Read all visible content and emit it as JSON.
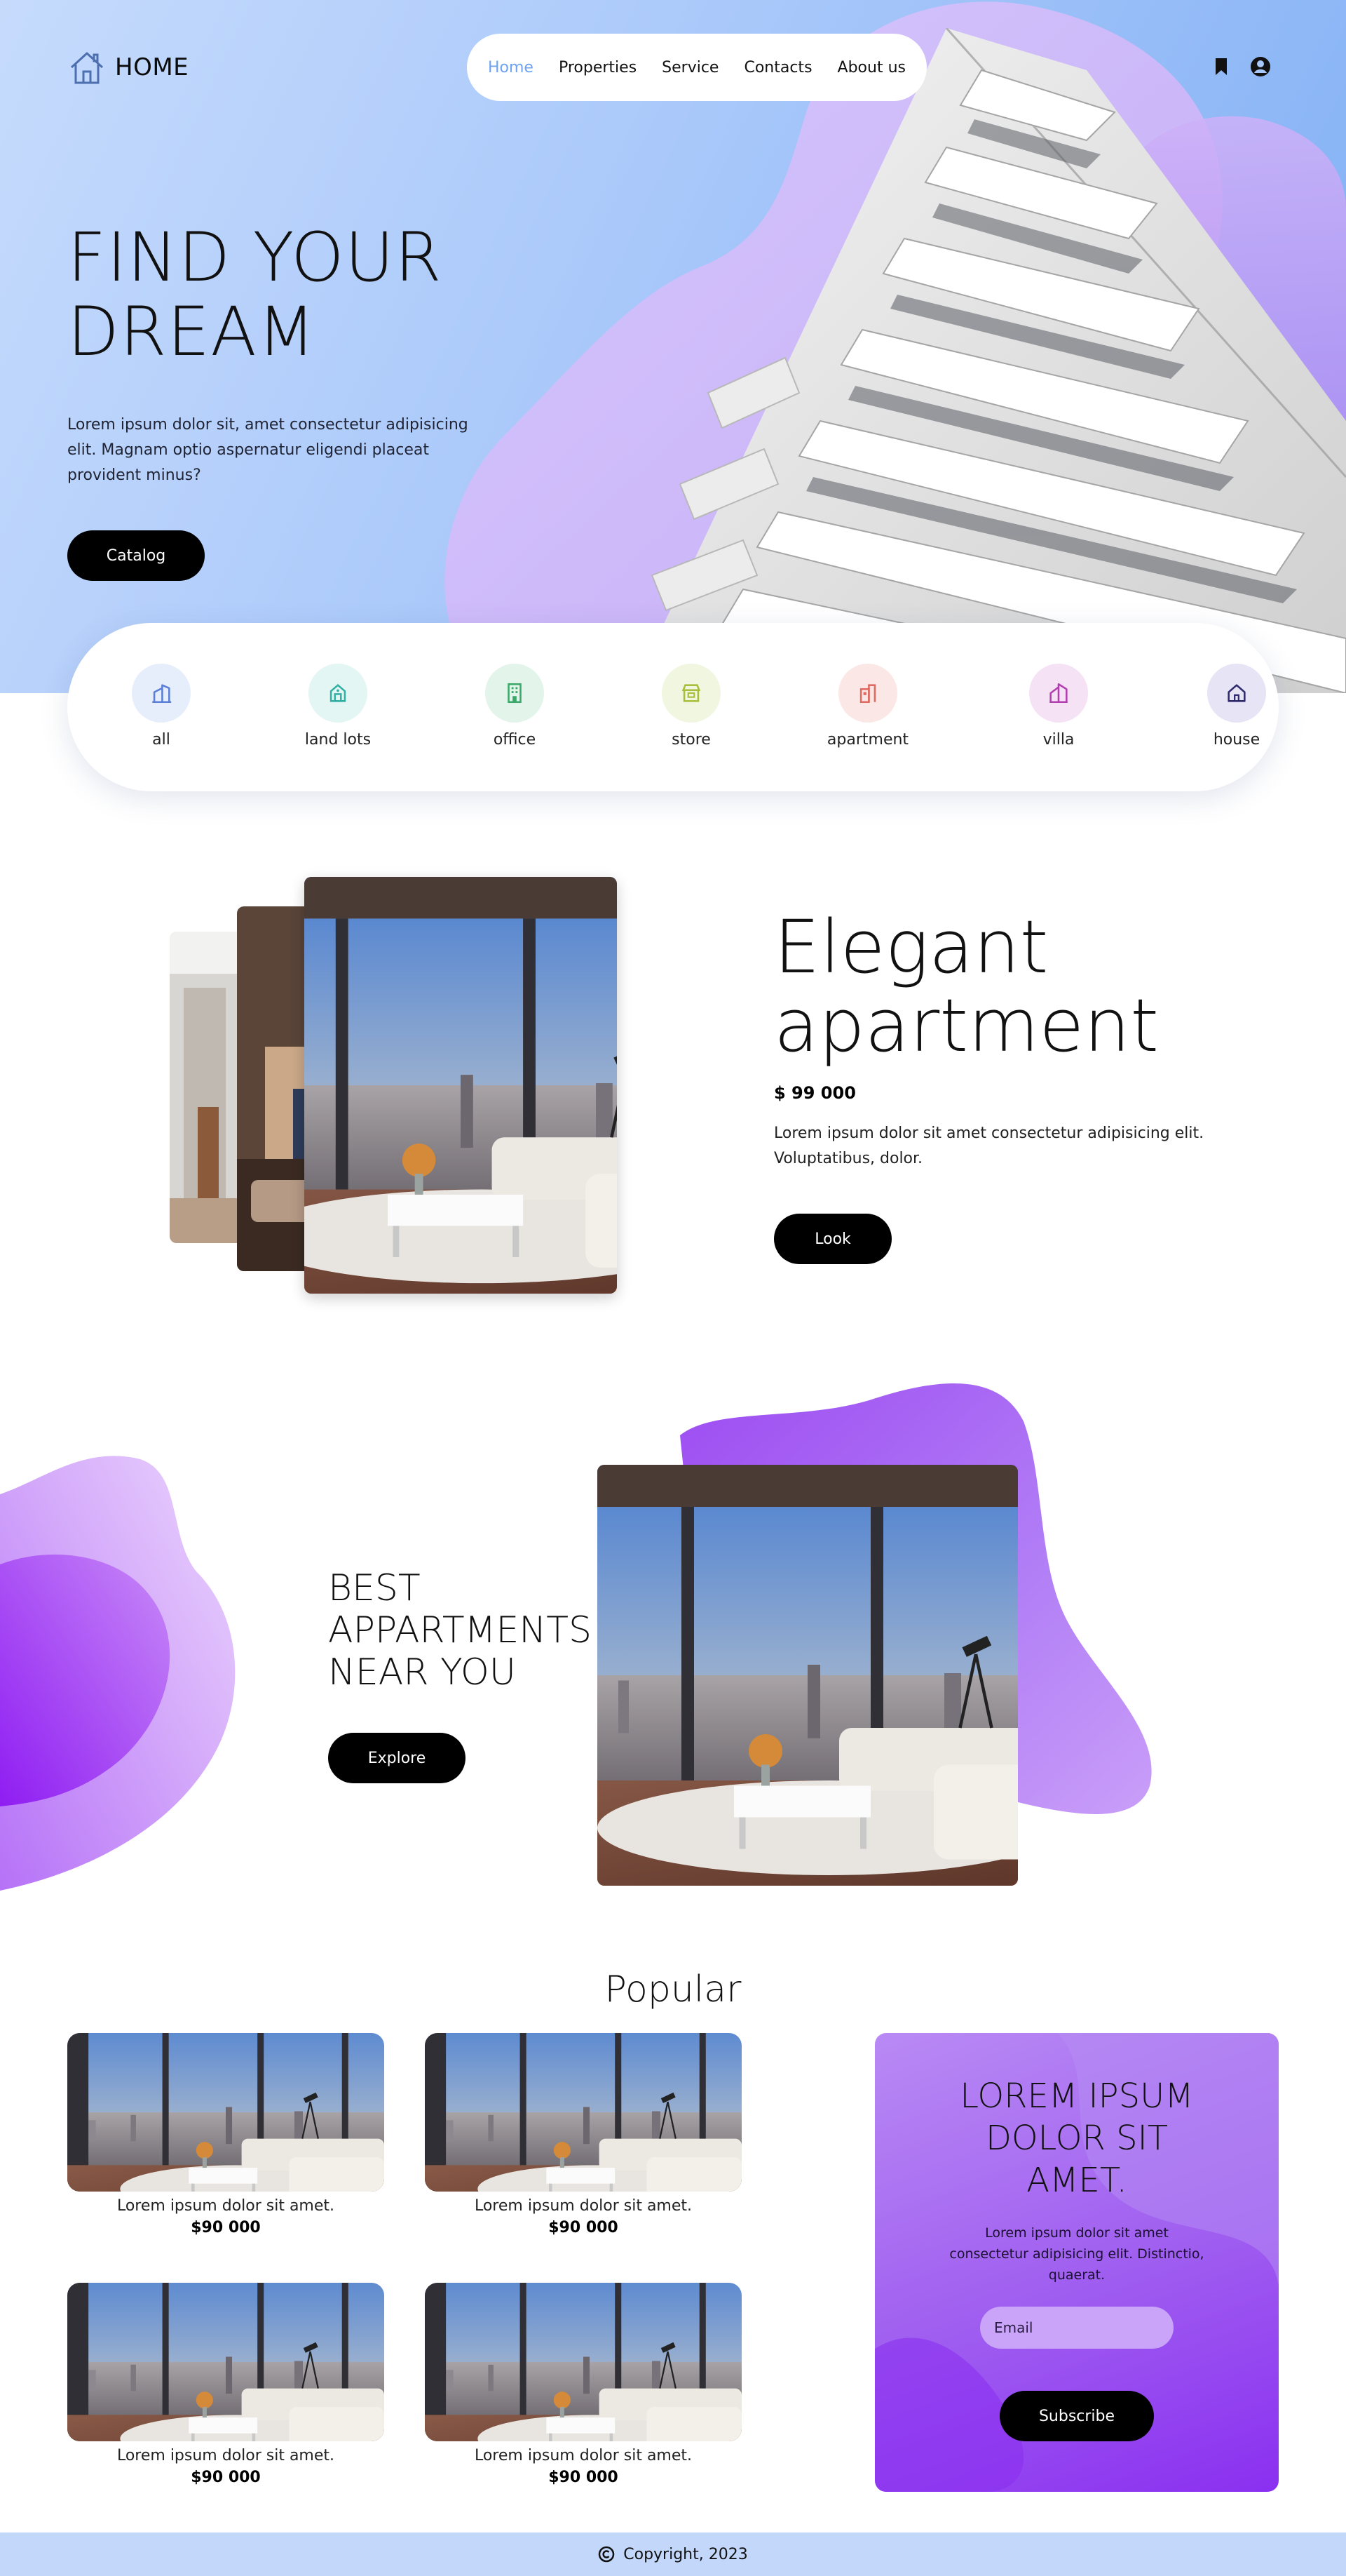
{
  "brand": {
    "logo_text": "HOME"
  },
  "nav": {
    "items": [
      "Home",
      "Properties",
      "Service",
      "Contacts",
      "About us"
    ],
    "active": "Home"
  },
  "hero": {
    "title_line1": "FIND YOUR",
    "title_line2": "DREAM",
    "text": "Lorem ipsum dolor sit, amet consectetur adipisicing elit. Magnam optio aspernatur eligendi placeat provident minus?",
    "button": "Catalog"
  },
  "categories": [
    {
      "label": "all",
      "icon": "building-icon",
      "color": "#5a7fd8",
      "bg": "#e6edfb"
    },
    {
      "label": "land lots",
      "icon": "land-icon",
      "color": "#33b0a4",
      "bg": "#e3f6f3"
    },
    {
      "label": "office",
      "icon": "office-icon",
      "color": "#3aa868",
      "bg": "#e3f5ea"
    },
    {
      "label": "store",
      "icon": "store-icon",
      "color": "#a7bf3a",
      "bg": "#f1f6e1"
    },
    {
      "label": "apartment",
      "icon": "apartment-icon",
      "color": "#e06a5f",
      "bg": "#fbe8e6"
    },
    {
      "label": "villa",
      "icon": "villa-icon",
      "color": "#b23fb0",
      "bg": "#f6e2f5"
    },
    {
      "label": "house",
      "icon": "house-icon",
      "color": "#2f2a6e",
      "bg": "#e6e4f5"
    }
  ],
  "featured": {
    "title_line1": "Elegant",
    "title_line2": "apartment",
    "price": "$ 99 000",
    "text": "Lorem ipsum dolor sit amet consectetur adipisicing elit. Voluptatibus, dolor.",
    "button": "Look"
  },
  "best": {
    "line1": "BEST",
    "line2": "APPARTMENTS",
    "line3": "NEAR YOU",
    "button": "Explore"
  },
  "popular": {
    "title": "Popular",
    "items": [
      {
        "caption": "Lorem ipsum dolor sit amet.",
        "price": "$90 000"
      },
      {
        "caption": "Lorem ipsum dolor sit amet.",
        "price": "$90 000"
      },
      {
        "caption": "Lorem ipsum dolor sit amet.",
        "price": "$90 000"
      },
      {
        "caption": "Lorem ipsum dolor sit amet.",
        "price": "$90 000"
      }
    ]
  },
  "promo": {
    "title_line1": "LOREM IPSUM",
    "title_line2": "DOLOR SIT",
    "title_line3": "AMET.",
    "text": "Lorem ipsum dolor sit amet consectetur adipisicing elit. Distinctio, quaerat.",
    "email_placeholder": "Email",
    "button": "Subscribe"
  },
  "footer": {
    "text": "Copyright, 2023",
    "icon": "copyright-icon"
  },
  "colors": {
    "accent": "#6fa3f2",
    "purple": "#9f5df0",
    "hero_bg": "#a9c8fa",
    "button": "#000000"
  }
}
